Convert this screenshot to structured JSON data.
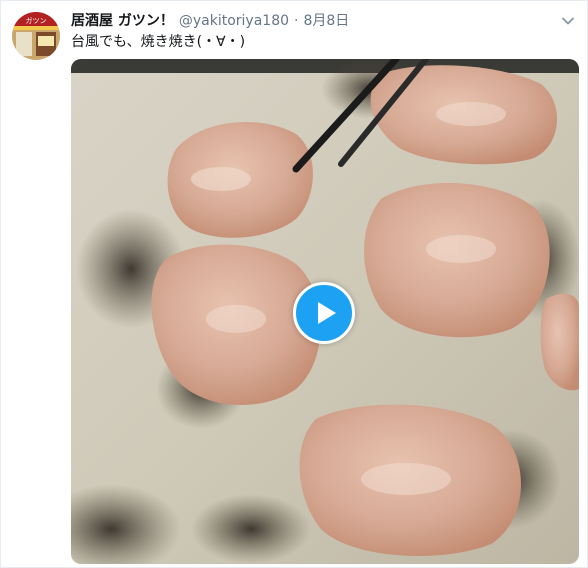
{
  "tweet": {
    "display_name": "居酒屋 ガツン！",
    "screen_name": "@yakitoriya180",
    "separator": "·",
    "timestamp": "8月8日",
    "text": "台風でも、焼き焼き(・∀・)",
    "avatar_sign_text": "ガツン"
  },
  "media": {
    "type": "video",
    "play_icon": "play-icon"
  },
  "icons": {
    "avatar": "avatar-icon",
    "menu": "chevron-down-icon"
  },
  "colors": {
    "accent": "#1da1f2",
    "name": "#14171a",
    "secondary": "#657786"
  }
}
